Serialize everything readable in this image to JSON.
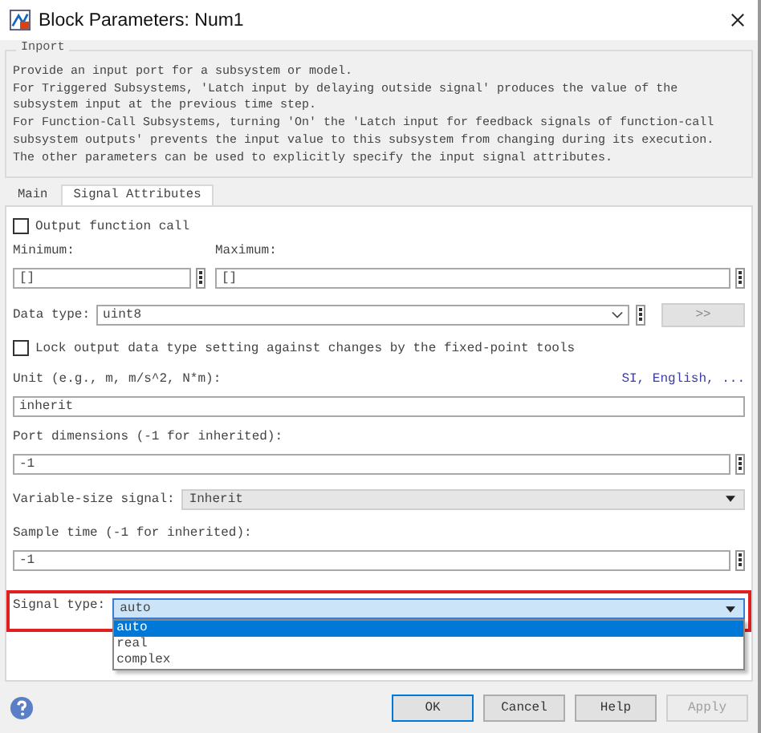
{
  "window": {
    "title": "Block Parameters: Num1"
  },
  "description": {
    "group": "Inport",
    "lines": [
      "Provide an input port for a subsystem or model.",
      "For Triggered Subsystems, 'Latch input by delaying outside signal' produces the value of the",
      "subsystem input at the previous time step.",
      "For Function-Call Subsystems, turning 'On' the 'Latch input for feedback signals of function-call",
      "subsystem outputs' prevents the input value to this subsystem from changing during its execution.",
      "The other parameters can be used to explicitly specify the input signal attributes."
    ]
  },
  "tabs": [
    {
      "label": "Main",
      "selected": false
    },
    {
      "label": "Signal Attributes",
      "selected": true
    }
  ],
  "parameters": [
    {
      "kind": "checkbox",
      "label": "Output function call",
      "checked": false
    },
    {
      "kind": "pair",
      "fields": [
        {
          "label": "Minimum:",
          "value": "[]"
        },
        {
          "label": "Maximum:",
          "value": "[]"
        }
      ]
    },
    {
      "kind": "datatype",
      "label": "Data type:",
      "value": "uint8",
      "button": ">>"
    },
    {
      "kind": "checkbox",
      "label": "Lock output data type setting against changes by the fixed-point tools",
      "checked": false
    },
    {
      "kind": "text",
      "label": "Unit (e.g., m, m/s^2, N*m):",
      "link": "SI, English, ...",
      "value": "inherit",
      "menu": false
    },
    {
      "kind": "text",
      "label": "Port dimensions (-1 for inherited):",
      "value": "-1",
      "menu": true
    },
    {
      "kind": "select",
      "label": "Variable-size signal:",
      "value": "Inherit",
      "highlighted": false,
      "open": false
    },
    {
      "kind": "text",
      "label": "Sample time (-1 for inherited):",
      "value": "-1",
      "menu": true
    },
    {
      "kind": "select",
      "label": "Signal type:",
      "value": "auto",
      "highlighted": true,
      "open": true,
      "options": [
        {
          "label": "auto",
          "selected": true
        },
        {
          "label": "real",
          "selected": false
        },
        {
          "label": "complex",
          "selected": false
        }
      ]
    }
  ],
  "buttons": [
    {
      "label": "OK",
      "default": true,
      "disabled": false
    },
    {
      "label": "Cancel",
      "default": false,
      "disabled": false
    },
    {
      "label": "Help",
      "default": false,
      "disabled": false
    },
    {
      "label": "Apply",
      "default": false,
      "disabled": true
    }
  ]
}
